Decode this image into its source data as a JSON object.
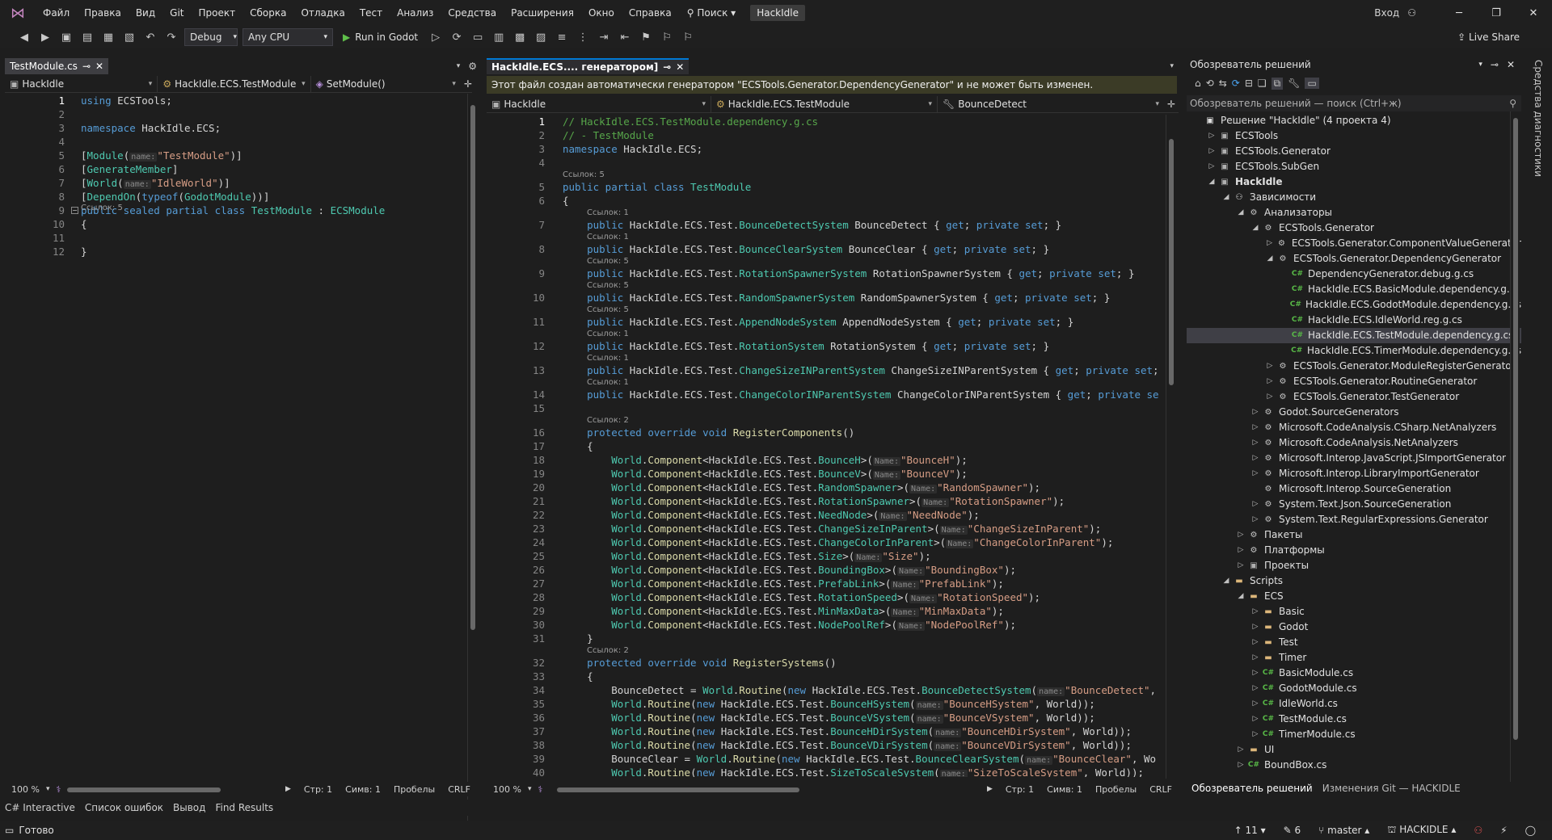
{
  "menu": {
    "items": [
      "Файл",
      "Правка",
      "Вид",
      "Git",
      "Проект",
      "Сборка",
      "Отладка",
      "Тест",
      "Анализ",
      "Средства",
      "Расширения",
      "Окно",
      "Справка"
    ],
    "search": "Поиск",
    "app_name": "HackIdle",
    "signin": "Вход"
  },
  "toolbar": {
    "config": "Debug",
    "platform": "Any CPU",
    "run_label": "Run in Godot",
    "live_share": "Live Share"
  },
  "left_editor": {
    "tab": "TestModule.cs",
    "nav": [
      "HackIdle",
      "HackIdle.ECS.TestModule",
      "SetModule()"
    ],
    "lines": [
      [
        {
          "t": "using ",
          "c": "kw"
        },
        {
          "t": "ECSTools;"
        }
      ],
      [],
      [
        {
          "t": "namespace ",
          "c": "kw"
        },
        {
          "t": "HackIdle.ECS;"
        }
      ],
      [],
      [
        {
          "t": "["
        },
        {
          "t": "Module",
          "c": "ty"
        },
        {
          "t": "("
        },
        {
          "t": "name:",
          "c": "hint"
        },
        {
          "t": "\"TestModule\"",
          "c": "st"
        },
        {
          "t": ")]"
        }
      ],
      [
        {
          "t": "["
        },
        {
          "t": "GenerateMember",
          "c": "ty"
        },
        {
          "t": "]"
        }
      ],
      [
        {
          "t": "["
        },
        {
          "t": "World",
          "c": "ty"
        },
        {
          "t": "("
        },
        {
          "t": "name:",
          "c": "hint"
        },
        {
          "t": "\"IdleWorld\"",
          "c": "st"
        },
        {
          "t": ")]"
        }
      ],
      [
        {
          "t": "["
        },
        {
          "t": "DependOn",
          "c": "ty"
        },
        {
          "t": "("
        },
        {
          "t": "typeof",
          "c": "kw"
        },
        {
          "t": "("
        },
        {
          "t": "GodotModule",
          "c": "ty"
        },
        {
          "t": "))]"
        }
      ],
      [
        {
          "t": "public sealed partial class ",
          "c": "kw"
        },
        {
          "t": "TestModule",
          "c": "ty"
        },
        {
          "t": " : "
        },
        {
          "t": "ECSModule",
          "c": "ty"
        }
      ],
      [
        {
          "t": "{"
        }
      ],
      [],
      [
        {
          "t": "}"
        }
      ]
    ],
    "ref_label": "Ссылок: 5",
    "zoom": "100 %",
    "status": [
      "Стр: 1",
      "Симв: 1",
      "Пробелы",
      "CRLF"
    ]
  },
  "right_editor": {
    "tab": "HackIdle.ECS.... генератором]",
    "banner": "Этот файл создан автоматически генератором \"ECSTools.Generator.DependencyGenerator\" и не может быть изменен.",
    "nav": [
      "HackIdle",
      "HackIdle.ECS.TestModule",
      "BounceDetect"
    ],
    "line_numbers": [
      "1",
      "2",
      "3",
      "4",
      "5",
      "6",
      "7",
      "8",
      "9",
      "10",
      "11",
      "12",
      "13",
      "14",
      "15",
      "16",
      "17",
      "18",
      "19",
      "20",
      "21",
      "22",
      "23",
      "24",
      "25",
      "26",
      "27",
      "28",
      "29",
      "30",
      "31",
      "32",
      "33",
      "34",
      "35",
      "36",
      "37",
      "38",
      "39",
      "40"
    ],
    "ref_labels": [
      "Ссылок: 5",
      "Ссылок: 1",
      "Ссылок: 1",
      "Ссылок: 5",
      "Ссылок: 5",
      "Ссылок: 5",
      "Ссылок: 1",
      "Ссылок: 1",
      "Ссылок: 1",
      "Ссылок: 2",
      "Ссылок: 2"
    ],
    "zoom": "100 %",
    "status": [
      "Стр: 1",
      "Симв: 1",
      "Пробелы",
      "CRLF"
    ]
  },
  "solution": {
    "title": "Обозреватель решений",
    "search_placeholder": "Обозреватель решений — поиск (Ctrl+ж)",
    "items": [
      {
        "d": 0,
        "ex": "",
        "ic": "sln",
        "t": "Решение \"HackIdle\"  (4 проекта 4)"
      },
      {
        "d": 1,
        "ex": "▷",
        "ic": "proj",
        "t": "ECSTools"
      },
      {
        "d": 1,
        "ex": "▷",
        "ic": "proj",
        "t": "ECSTools.Generator"
      },
      {
        "d": 1,
        "ex": "▷",
        "ic": "proj",
        "t": "ECSTools.SubGen"
      },
      {
        "d": 1,
        "ex": "◢",
        "ic": "proj",
        "t": "HackIdle",
        "b": true
      },
      {
        "d": 2,
        "ex": "◢",
        "ic": "dep",
        "t": "Зависимости"
      },
      {
        "d": 3,
        "ex": "◢",
        "ic": "gear",
        "t": "Анализаторы"
      },
      {
        "d": 4,
        "ex": "◢",
        "ic": "gear",
        "t": "ECSTools.Generator"
      },
      {
        "d": 5,
        "ex": "▷",
        "ic": "gear",
        "t": "ECSTools.Generator.ComponentValueGenerator"
      },
      {
        "d": 5,
        "ex": "◢",
        "ic": "gear",
        "t": "ECSTools.Generator.DependencyGenerator"
      },
      {
        "d": 6,
        "ex": "",
        "ic": "cs",
        "t": "DependencyGenerator.debug.g.cs"
      },
      {
        "d": 6,
        "ex": "",
        "ic": "cs",
        "t": "HackIdle.ECS.BasicModule.dependency.g.cs"
      },
      {
        "d": 6,
        "ex": "",
        "ic": "cs",
        "t": "HackIdle.ECS.GodotModule.dependency.g.cs"
      },
      {
        "d": 6,
        "ex": "",
        "ic": "cs",
        "t": "HackIdle.ECS.IdleWorld.reg.g.cs"
      },
      {
        "d": 6,
        "ex": "",
        "ic": "cs",
        "t": "HackIdle.ECS.TestModule.dependency.g.cs",
        "sel": true
      },
      {
        "d": 6,
        "ex": "",
        "ic": "cs",
        "t": "HackIdle.ECS.TimerModule.dependency.g.cs"
      },
      {
        "d": 5,
        "ex": "▷",
        "ic": "gear",
        "t": "ECSTools.Generator.ModuleRegisterGenerator"
      },
      {
        "d": 5,
        "ex": "▷",
        "ic": "gear",
        "t": "ECSTools.Generator.RoutineGenerator"
      },
      {
        "d": 5,
        "ex": "▷",
        "ic": "gear",
        "t": "ECSTools.Generator.TestGenerator"
      },
      {
        "d": 4,
        "ex": "▷",
        "ic": "gear",
        "t": "Godot.SourceGenerators"
      },
      {
        "d": 4,
        "ex": "▷",
        "ic": "gear",
        "t": "Microsoft.CodeAnalysis.CSharp.NetAnalyzers"
      },
      {
        "d": 4,
        "ex": "▷",
        "ic": "gear",
        "t": "Microsoft.CodeAnalysis.NetAnalyzers"
      },
      {
        "d": 4,
        "ex": "▷",
        "ic": "gear",
        "t": "Microsoft.Interop.JavaScript.JSImportGenerator"
      },
      {
        "d": 4,
        "ex": "▷",
        "ic": "gear",
        "t": "Microsoft.Interop.LibraryImportGenerator"
      },
      {
        "d": 4,
        "ex": "",
        "ic": "gear",
        "t": "Microsoft.Interop.SourceGeneration"
      },
      {
        "d": 4,
        "ex": "▷",
        "ic": "gear",
        "t": "System.Text.Json.SourceGeneration"
      },
      {
        "d": 4,
        "ex": "▷",
        "ic": "gear",
        "t": "System.Text.RegularExpressions.Generator"
      },
      {
        "d": 3,
        "ex": "▷",
        "ic": "gear",
        "t": "Пакеты"
      },
      {
        "d": 3,
        "ex": "▷",
        "ic": "gear",
        "t": "Платформы"
      },
      {
        "d": 3,
        "ex": "▷",
        "ic": "proj",
        "t": "Проекты"
      },
      {
        "d": 2,
        "ex": "◢",
        "ic": "folder",
        "t": "Scripts"
      },
      {
        "d": 3,
        "ex": "◢",
        "ic": "folder",
        "t": "ECS"
      },
      {
        "d": 4,
        "ex": "▷",
        "ic": "folder",
        "t": "Basic"
      },
      {
        "d": 4,
        "ex": "▷",
        "ic": "folder",
        "t": "Godot"
      },
      {
        "d": 4,
        "ex": "▷",
        "ic": "folder",
        "t": "Test"
      },
      {
        "d": 4,
        "ex": "▷",
        "ic": "folder",
        "t": "Timer"
      },
      {
        "d": 4,
        "ex": "▷",
        "ic": "cs",
        "t": "BasicModule.cs"
      },
      {
        "d": 4,
        "ex": "▷",
        "ic": "cs",
        "t": "GodotModule.cs"
      },
      {
        "d": 4,
        "ex": "▷",
        "ic": "cs",
        "t": "IdleWorld.cs"
      },
      {
        "d": 4,
        "ex": "▷",
        "ic": "cs",
        "t": "TestModule.cs"
      },
      {
        "d": 4,
        "ex": "▷",
        "ic": "cs",
        "t": "TimerModule.cs"
      },
      {
        "d": 3,
        "ex": "▷",
        "ic": "folder",
        "t": "UI"
      },
      {
        "d": 3,
        "ex": "▷",
        "ic": "cs",
        "t": "BoundBox.cs"
      }
    ],
    "tabs": [
      "Обозреватель решений",
      "Изменения Git — HACKIDLE"
    ]
  },
  "right_strip": "Средства диагностики",
  "output_tabs": [
    "C# Interactive",
    "Список ошибок",
    "Вывод",
    "Find Results"
  ],
  "statusbar": {
    "ready": "Готово",
    "errors": "11",
    "edits": "6",
    "branch": "master",
    "repo": "HACKIDLE"
  }
}
